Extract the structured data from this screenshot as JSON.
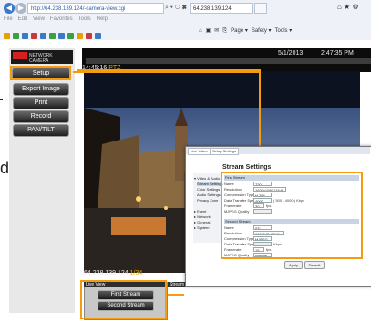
{
  "browser": {
    "address": "http://64.238.139.124/-camera-view.cgi",
    "address_controls": "⌕ ▾ ↻ ✖",
    "tabs": [
      {
        "label": "64.238.139.124"
      },
      {
        "label": ""
      }
    ],
    "window_icons": "⌂ ★ ⚙",
    "menu": [
      "File",
      "Edit",
      "View",
      "Favorites",
      "Tools",
      "Help"
    ],
    "command_bar": [
      "Page ▾",
      "Safety ▾",
      "Tools ▾"
    ]
  },
  "sidebar": {
    "logo_text": "NETWORK CAMERA",
    "buttons": [
      {
        "label": "Setup"
      },
      {
        "label": "Export Image"
      },
      {
        "label": "Print"
      },
      {
        "label": "Record"
      },
      {
        "label": "PAN/TILT"
      }
    ]
  },
  "camera": {
    "date": "5/1/2013",
    "time": "2:47:35 PM",
    "osd_time": "14:45:16",
    "osd_mode": "PTZ",
    "osd_ip": "64.238.139.124",
    "osd_fps": "1/34"
  },
  "live_view": {
    "header": "Live View",
    "first_stream": "First Stream",
    "second_stream": "Second Stream",
    "stream_header_2": "Stream"
  },
  "popup": {
    "tabs": [
      "Live Video",
      "Setup Settings"
    ],
    "nav": [
      "▾ Video & Audio",
      "Stream Settings",
      "Color Settings",
      "Audio Settings",
      "Privacy Zone",
      "▸ Event",
      "▸ Network",
      "▸ General",
      "▸ System"
    ],
    "title": "Stream Settings",
    "first_header": "First Stream",
    "second_header": "Second Stream",
    "first_fields": [
      {
        "label": "Name",
        "value": "720",
        "extra": ""
      },
      {
        "label": "Resolution",
        "value": "1920x1080 (16:9)",
        "extra": ""
      },
      {
        "label": "Compression Type",
        "value": "H.264",
        "extra": ""
      },
      {
        "label": "Data Transfer Speed",
        "value": "4000",
        "extra": "( 500 - 4000 ) Kbps"
      },
      {
        "label": "Framerate",
        "value": "30",
        "extra": "fps"
      },
      {
        "label": "MJPEG Quality",
        "value": "",
        "extra": ""
      }
    ],
    "second_fields": [
      {
        "label": "Name",
        "value": "SD",
        "extra": ""
      },
      {
        "label": "Resolution",
        "value": "960x540 (16:9)",
        "extra": ""
      },
      {
        "label": "Compression Type",
        "value": "MJPEG",
        "extra": ""
      },
      {
        "label": "Data Transfer Speed",
        "value": "",
        "extra": "Kbps"
      },
      {
        "label": "Framerate",
        "value": "15",
        "extra": "fps"
      },
      {
        "label": "MJPEG Quality",
        "value": "Normal",
        "extra": ""
      }
    ],
    "apply": "Apply",
    "default": "Default"
  },
  "edge_text": "d",
  "colors": {
    "highlight": "#f39c12",
    "link_blue": "#2a5ea8"
  }
}
